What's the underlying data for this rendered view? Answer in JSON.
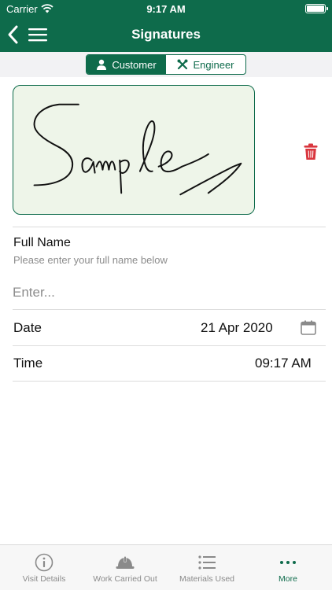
{
  "status": {
    "carrier": "Carrier",
    "time": "9:17 AM"
  },
  "nav": {
    "title": "Signatures"
  },
  "segments": [
    {
      "label": "Customer",
      "icon": "person-icon",
      "active": true
    },
    {
      "label": "Engineer",
      "icon": "tools-icon",
      "active": false
    }
  ],
  "signature": {
    "delete_icon": "trash-icon"
  },
  "full_name": {
    "label": "Full Name",
    "hint": "Please enter your full name below",
    "value": "",
    "placeholder": "Enter..."
  },
  "date": {
    "label": "Date",
    "value": "21 Apr 2020",
    "icon": "calendar-icon"
  },
  "time": {
    "label": "Time",
    "value": "09:17 AM"
  },
  "tabbar": [
    {
      "label": "Visit Details",
      "icon": "info-icon",
      "active": false
    },
    {
      "label": "Work Carried Out",
      "icon": "hard-hat-icon",
      "active": false
    },
    {
      "label": "Materials Used",
      "icon": "list-icon",
      "active": false
    },
    {
      "label": "More",
      "icon": "more-dots-icon",
      "active": true
    }
  ],
  "colors": {
    "brand": "#0e6b4b",
    "signature_bg": "#eef5e9",
    "delete": "#d9363e"
  }
}
